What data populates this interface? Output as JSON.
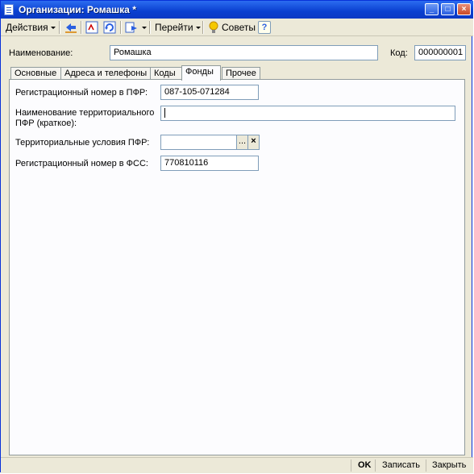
{
  "window": {
    "title": "Организации: Ромашка *",
    "minimize_icon": "minimize-icon",
    "maximize_icon": "maximize-icon",
    "close_icon": "close-icon"
  },
  "toolbar": {
    "actions_label": "Действия",
    "goto_label": "Перейти",
    "tips_label": "Советы",
    "help_glyph": "?",
    "icons": [
      "back-arrow-icon",
      "edit-icon",
      "refresh-icon",
      "document-convert-icon",
      "help-icon",
      "lightbulb-icon"
    ]
  },
  "header": {
    "name_label": "Наименование:",
    "name_value": "Ромашка",
    "code_label": "Код:",
    "code_value": "000000001"
  },
  "tabs": [
    {
      "label": "Основные"
    },
    {
      "label": "Адреса и телефоны"
    },
    {
      "label": "Коды"
    },
    {
      "label": "Фонды"
    },
    {
      "label": "Прочее"
    }
  ],
  "active_tab": "Фонды",
  "fields": {
    "pfr_reg_label": "Регистрационный номер в ПФР:",
    "pfr_reg_value": "087-105-071284",
    "pfr_name_label": "Наименование территориального ПФР (краткое):",
    "pfr_name_value": "",
    "pfr_terms_label": "Территориальные условия ПФР:",
    "pfr_terms_value": "",
    "pfr_terms_select_glyph": "...",
    "pfr_terms_clear_glyph": "×",
    "fss_reg_label": "Регистрационный номер в ФСС:",
    "fss_reg_value": "770810116"
  },
  "footer": {
    "ok_label": "OK",
    "save_label": "Записать",
    "close_label": "Закрыть"
  },
  "colors": {
    "titlebar": "#0a3fd0",
    "window_bg": "#ece9d8",
    "panel_bg": "#fcfcfe",
    "field_border": "#7f9db9"
  }
}
